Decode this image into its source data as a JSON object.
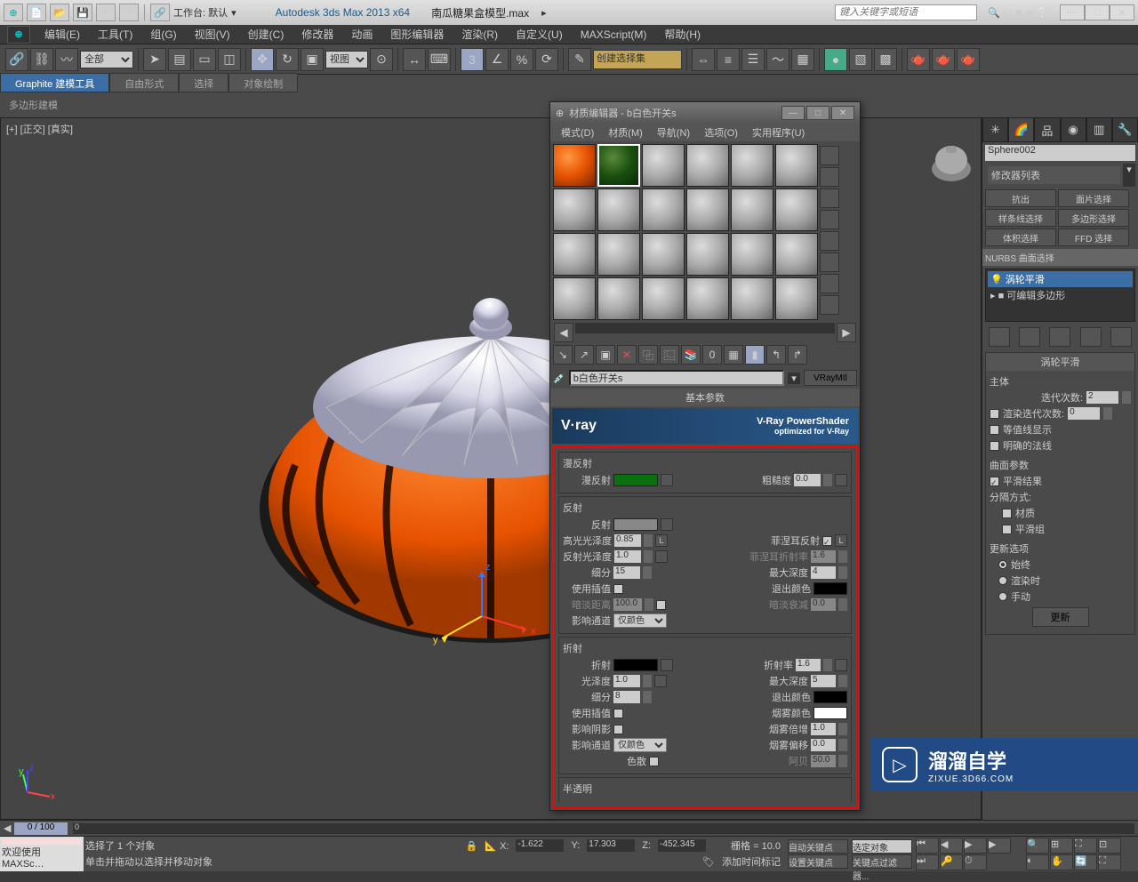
{
  "titlebar": {
    "workspace_label": "工作台: 默认",
    "app_title": "Autodesk 3ds Max  2013 x64",
    "doc_title": "南瓜糖果盒模型.max",
    "search_placeholder": "键入关键字或短语"
  },
  "menubar": {
    "items": [
      "编辑(E)",
      "工具(T)",
      "组(G)",
      "视图(V)",
      "创建(C)",
      "修改器",
      "动画",
      "图形编辑器",
      "渲染(R)",
      "自定义(U)",
      "MAXScript(M)",
      "帮助(H)"
    ]
  },
  "toolbar": {
    "filter": "全部",
    "view": "视图",
    "named_set": "创建选择集"
  },
  "ribbon": {
    "tabs": [
      "Graphite 建模工具",
      "自由形式",
      "选择",
      "对象绘制"
    ],
    "content": "多边形建模"
  },
  "viewport": {
    "label": "[+] [正交] [真实]"
  },
  "cmd_panel": {
    "object_name": "Sphere002",
    "mod_list_label": "修改器列表",
    "buttons": [
      "抗出",
      "面片选择",
      "样条线选择",
      "多边形选择",
      "体积选择",
      "FFD 选择"
    ],
    "nurbs": "NURBS 曲面选择",
    "stack": {
      "items": [
        "涡轮平滑",
        "可编辑多边形"
      ],
      "selected": 0
    },
    "turbosmooth": {
      "header": "涡轮平滑",
      "main": "主体",
      "iter_label": "迭代次数:",
      "iter": "2",
      "render_iter_label": "渲染迭代次数:",
      "render_iter": "0",
      "isolines_label": "等值线显示",
      "explicit_label": "明确的法线",
      "surface_label": "曲面参数",
      "smooth_result_label": "平滑结果",
      "sep_label": "分隔方式:",
      "materials_label": "材质",
      "smooth_groups_label": "平滑组",
      "update_opts_label": "更新选项",
      "always_label": "始终",
      "render_label": "渲染时",
      "manual_label": "手动",
      "update_btn": "更新"
    }
  },
  "mat_editor": {
    "title": "材质编辑器 - b白色开关s",
    "menu": [
      "模式(D)",
      "材质(M)",
      "导航(N)",
      "选项(O)",
      "实用程序(U)"
    ],
    "name": "b白色开关s",
    "type": "VRayMtl",
    "basic_header": "基本参数",
    "vray": {
      "logo": "V·ray",
      "title": "V-Ray PowerShader",
      "subtitle": "optimized for V-Ray"
    },
    "diffuse": {
      "section": "漫反射",
      "diffuse_label": "漫反射",
      "rough_label": "粗糙度",
      "rough": "0.0"
    },
    "reflect": {
      "section": "反射",
      "reflect_label": "反射",
      "hilight_label": "高光光泽度",
      "hilight": "0.85",
      "refl_gloss_label": "反射光泽度",
      "refl_gloss": "1.0",
      "subdivs_label": "细分",
      "subdivs": "15",
      "interp_label": "使用插值",
      "dim_label": "暗淡距离",
      "dim": "100.0",
      "channels_label": "影响通道",
      "channels": "仅颜色",
      "fresnel_label": "菲涅耳反射",
      "fresnel_ior_label": "菲涅耳折射率",
      "fresnel_ior": "1.6",
      "max_depth_label": "最大深度",
      "max_depth": "4",
      "exit_label": "退出颜色",
      "dim_falloff_label": "暗淡衰减",
      "dim_falloff": "0.0",
      "l_btn": "L"
    },
    "refract": {
      "section": "折射",
      "refract_label": "折射",
      "gloss_label": "光泽度",
      "gloss": "1.0",
      "subdivs_label": "细分",
      "subdivs": "8",
      "interp_label": "使用插值",
      "shadows_label": "影响阴影",
      "channels_label": "影响通道",
      "channels": "仅颜色",
      "ior_label": "折射率",
      "ior": "1.6",
      "max_depth_label": "最大深度",
      "max_depth": "5",
      "exit_label": "退出颜色",
      "fog_label": "烟雾颜色",
      "fog_mult_label": "烟雾倍增",
      "fog_mult": "1.0",
      "fog_bias_label": "烟雾偏移",
      "fog_bias": "0.0",
      "dispersion_label": "色散",
      "abbe_label": "阿贝",
      "abbe": "50.0"
    },
    "translucency": "半透明"
  },
  "watermark": {
    "main": "溜溜自学",
    "sub": "ZIXUE.3D66.COM"
  },
  "timeslider": {
    "frame": "0 / 100",
    "ticks": "0"
  },
  "statusbar": {
    "welcome": "欢迎使用  MAXSc…",
    "sel_info": "选择了 1 个对象",
    "hint": "单击并拖动以选择并移动对象",
    "x": "-1.622",
    "y": "17.303",
    "z": "-452.345",
    "grid": "栅格 = 10.0",
    "add_time_tag": "添加时间标记",
    "autokey": "自动关键点",
    "selected": "选定对象",
    "setkey": "设置关键点",
    "key_filters": "关键点过滤器..."
  }
}
